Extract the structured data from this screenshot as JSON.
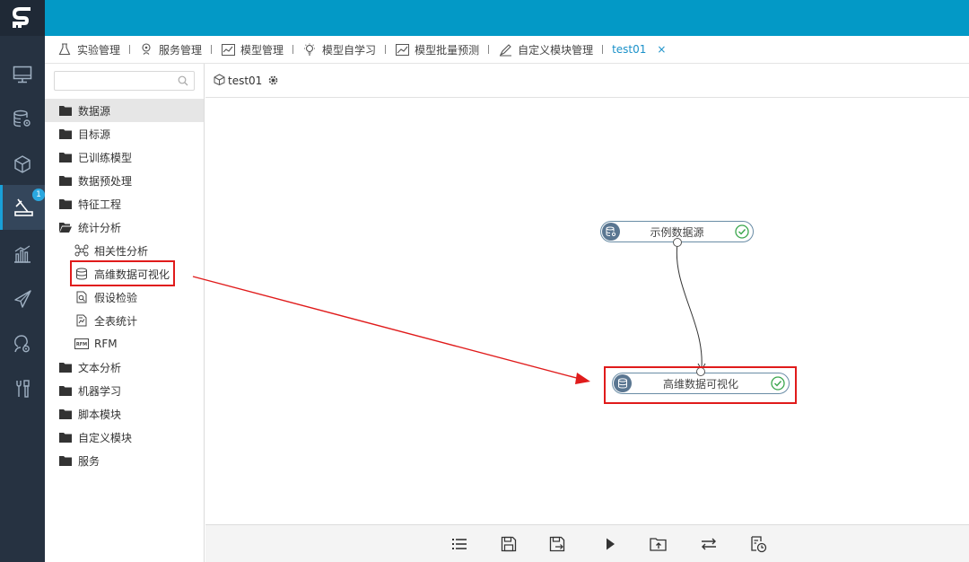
{
  "app": {
    "logo": "S"
  },
  "rail": {
    "items": [
      {
        "icon": "monitor-icon"
      },
      {
        "icon": "database-settings-icon"
      },
      {
        "icon": "cube-icon"
      },
      {
        "icon": "model-lab-icon",
        "badge": "1",
        "active": true
      },
      {
        "icon": "bar-chart-icon"
      },
      {
        "icon": "paper-plane-icon"
      },
      {
        "icon": "user-settings-icon"
      },
      {
        "icon": "tools-icon"
      }
    ]
  },
  "tabs": [
    {
      "label": "实验管理",
      "icon": "flask-icon"
    },
    {
      "label": "服务管理",
      "icon": "service-icon"
    },
    {
      "label": "模型管理",
      "icon": "model-chart-icon"
    },
    {
      "label": "模型自学习",
      "icon": "lightbulb-icon"
    },
    {
      "label": "模型批量预测",
      "icon": "trend-chart-icon"
    },
    {
      "label": "自定义模块管理",
      "icon": "edit-module-icon"
    },
    {
      "label": "test01",
      "active": true,
      "close": "×"
    }
  ],
  "search": {
    "placeholder": "",
    "value": ""
  },
  "tree": {
    "folders": [
      {
        "label": "数据源"
      },
      {
        "label": "目标源"
      },
      {
        "label": "已训练模型"
      },
      {
        "label": "数据预处理"
      },
      {
        "label": "特征工程"
      },
      {
        "label": "统计分析"
      },
      {
        "label": "文本分析"
      },
      {
        "label": "机器学习"
      },
      {
        "label": "脚本模块"
      },
      {
        "label": "自定义模块"
      },
      {
        "label": "服务"
      }
    ],
    "children": [
      {
        "label": "相关性分析",
        "icon": "correlation-icon"
      },
      {
        "label": "高维数据可视化",
        "icon": "database-icon"
      },
      {
        "label": "假设检验",
        "icon": "hypothesis-icon"
      },
      {
        "label": "全表统计",
        "icon": "table-stats-icon"
      },
      {
        "label": "RFM",
        "icon": "rfm-icon",
        "icon_text": "RFM"
      }
    ]
  },
  "canvas": {
    "title": "test01",
    "nodes": [
      {
        "label": "示例数据源",
        "status": "success"
      },
      {
        "label": "高维数据可视化",
        "status": "success"
      }
    ]
  },
  "toolbar": {
    "buttons": [
      {
        "icon": "list-icon"
      },
      {
        "icon": "save-icon"
      },
      {
        "icon": "save-as-icon"
      },
      {
        "icon": "run-icon"
      },
      {
        "icon": "export-icon"
      },
      {
        "icon": "refresh-icon"
      },
      {
        "icon": "schedule-icon"
      }
    ]
  },
  "colors": {
    "topbar": "#0399c6",
    "rail": "#263241",
    "highlight": "#e01b1b",
    "active_tab": "#1a91c9",
    "success": "#3aa64c"
  }
}
